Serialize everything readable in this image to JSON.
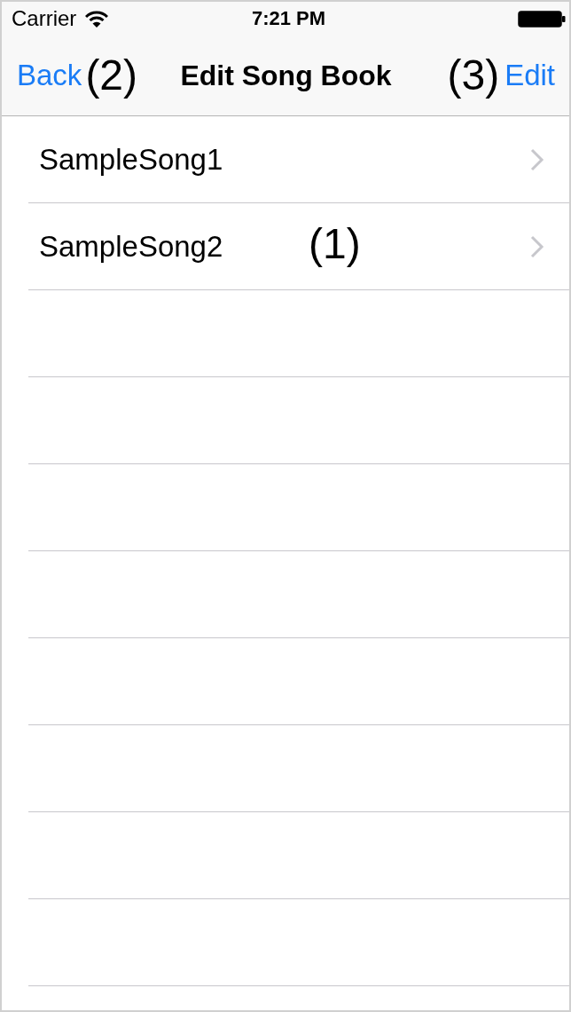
{
  "status_bar": {
    "carrier": "Carrier",
    "time": "7:21 PM"
  },
  "nav_bar": {
    "back": "Back",
    "back_note": "(2)",
    "title": "Edit Song Book",
    "edit_note": "(3)",
    "edit": "Edit"
  },
  "songs": [
    {
      "title": "SampleSong1"
    },
    {
      "title": "SampleSong2"
    }
  ],
  "list_note": "(1)"
}
